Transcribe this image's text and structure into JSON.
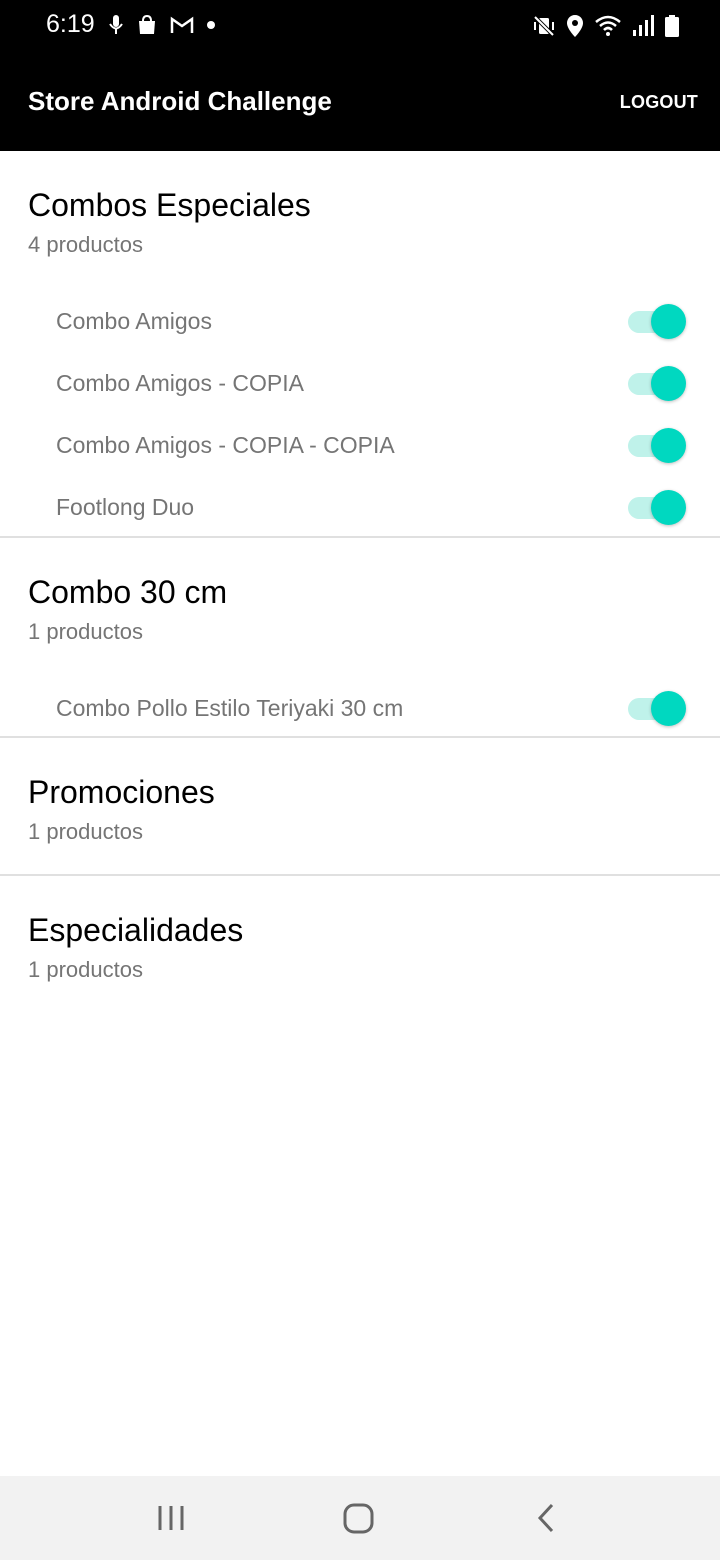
{
  "status_bar": {
    "time": "6:19",
    "left_icons": [
      "mic-icon",
      "shopping-bag-icon",
      "gmail-icon",
      "dot-icon"
    ],
    "right_icons": [
      "vibrate-mute-icon",
      "location-icon",
      "wifi-icon",
      "signal-icon",
      "battery-icon"
    ]
  },
  "app_bar": {
    "title": "Store Android Challenge",
    "logout_label": "LOGOUT"
  },
  "accent_color": "#00d8c0",
  "categories": [
    {
      "title": "Combos Especiales",
      "count": "4 productos",
      "items": [
        {
          "label": "Combo Amigos",
          "enabled": true
        },
        {
          "label": "Combo Amigos - COPIA",
          "enabled": true
        },
        {
          "label": "Combo Amigos - COPIA - COPIA",
          "enabled": true
        },
        {
          "label": "Footlong Duo",
          "enabled": true
        }
      ]
    },
    {
      "title": "Combo 30 cm",
      "count": "1 productos",
      "items": [
        {
          "label": "Combo Pollo Estilo Teriyaki 30 cm",
          "enabled": true
        }
      ]
    },
    {
      "title": "Promociones",
      "count": "1 productos",
      "items": []
    },
    {
      "title": "Especialidades",
      "count": "1 productos",
      "items": []
    }
  ],
  "nav_bar": {
    "buttons": [
      "recent-apps-icon",
      "home-icon",
      "back-icon"
    ]
  }
}
